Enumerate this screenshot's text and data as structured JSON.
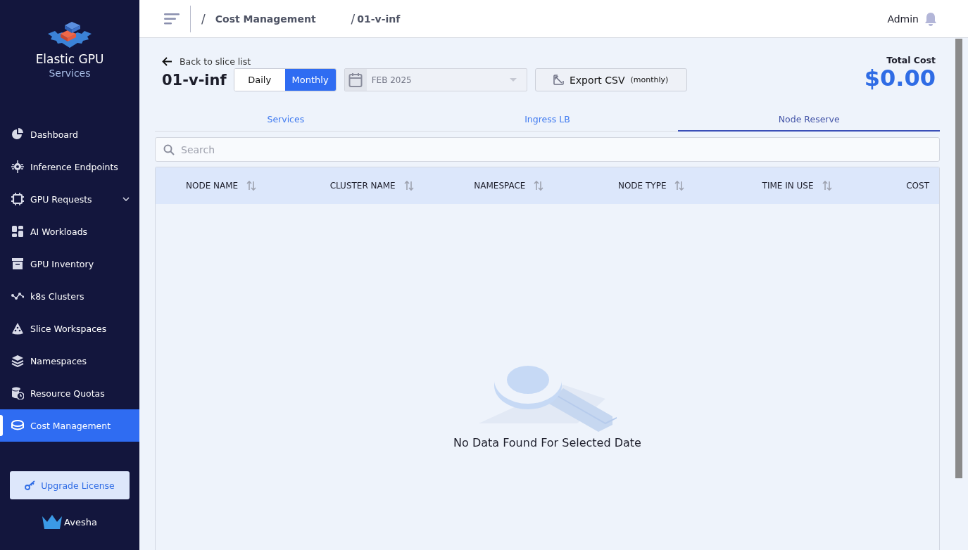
{
  "sidebar": {
    "brand_title": "Elastic GPU",
    "brand_subtitle": "Services",
    "items": [
      {
        "label": "Dashboard",
        "selected": false,
        "expandable": false
      },
      {
        "label": "Inference Endpoints",
        "selected": false,
        "expandable": false
      },
      {
        "label": "GPU Requests",
        "selected": false,
        "expandable": true
      },
      {
        "label": "AI Workloads",
        "selected": false,
        "expandable": false
      },
      {
        "label": "GPU Inventory",
        "selected": false,
        "expandable": false
      },
      {
        "label": "k8s Clusters",
        "selected": false,
        "expandable": false
      },
      {
        "label": "Slice Workspaces",
        "selected": false,
        "expandable": false
      },
      {
        "label": "Namespaces",
        "selected": false,
        "expandable": false
      },
      {
        "label": "Resource Quotas",
        "selected": false,
        "expandable": false
      },
      {
        "label": "Cost Management",
        "selected": true,
        "expandable": false
      }
    ],
    "upgrade_button": "Upgrade License",
    "footer_logo": "Avesha"
  },
  "header": {
    "breadcrumbs": [
      {
        "separator": "/",
        "label": "Cost Management"
      },
      {
        "separator": "/",
        "label": "01-v-inf"
      }
    ],
    "user": "Admin"
  },
  "page": {
    "back_link": "Back to slice list",
    "title": "01-v-inf",
    "period_toggle": [
      {
        "label": "Daily",
        "selected": false
      },
      {
        "label": "Monthly",
        "selected": true
      }
    ],
    "date_picker": {
      "value": "FEB 2025"
    },
    "export_button": {
      "label": "Export CSV",
      "suffix": "(monthly)"
    },
    "total_cost": {
      "label": "Total Cost",
      "value": "$0.00"
    },
    "tabs": [
      {
        "label": "Services",
        "selected": false
      },
      {
        "label": "Ingress LB",
        "selected": false
      },
      {
        "label": "Node Reserve",
        "selected": true
      }
    ],
    "search": {
      "placeholder": "Search"
    },
    "table": {
      "columns": [
        {
          "label": "NODE NAME",
          "sortable": true
        },
        {
          "label": "CLUSTER NAME",
          "sortable": true
        },
        {
          "label": "NAMESPACE",
          "sortable": true
        },
        {
          "label": "NODE TYPE",
          "sortable": true
        },
        {
          "label": "TIME IN USE",
          "sortable": true
        },
        {
          "label": "COST",
          "sortable": false
        }
      ],
      "empty_message": "No Data Found For Selected Date"
    }
  }
}
